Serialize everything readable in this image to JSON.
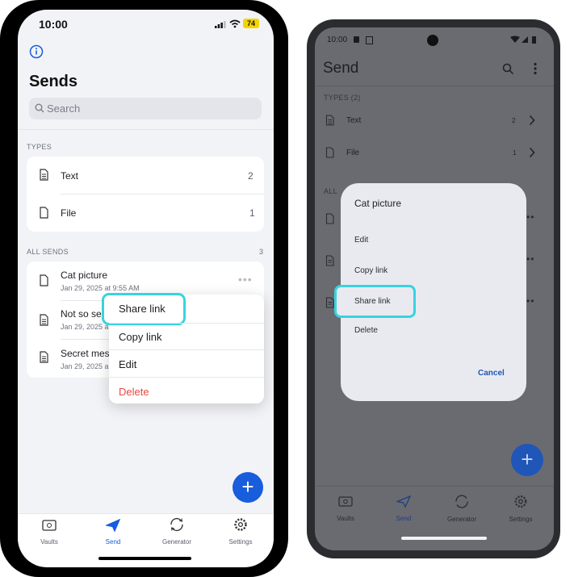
{
  "ios": {
    "time": "10:00",
    "battery": "74",
    "title": "Sends",
    "search_placeholder": "Search",
    "types_label": "TYPES",
    "types": [
      {
        "label": "Text",
        "count": "2"
      },
      {
        "label": "File",
        "count": "1"
      }
    ],
    "all_sends_label": "ALL SENDS",
    "all_sends_count": "3",
    "sends": [
      {
        "name": "Cat picture",
        "date": "Jan 29, 2025 at 9:55 AM"
      },
      {
        "name": "Not so secr",
        "date": "Jan 29, 2025 a"
      },
      {
        "name": "Secret mes",
        "date": "Jan 29, 2025 a"
      }
    ],
    "menu": {
      "share": "Share link",
      "copy": "Copy link",
      "edit": "Edit",
      "delete": "Delete"
    },
    "tabs": [
      "Vaults",
      "Send",
      "Generator",
      "Settings"
    ],
    "accent": "#175ddc",
    "danger": "#e5483f"
  },
  "android": {
    "time": "10:00",
    "title": "Send",
    "types_label": "TYPES (2)",
    "types": [
      {
        "label": "Text",
        "count": "2"
      },
      {
        "label": "File",
        "count": "1"
      }
    ],
    "all_label": "ALL",
    "dialog": {
      "title": "Cat picture",
      "edit": "Edit",
      "copy": "Copy link",
      "share": "Share link",
      "delete": "Delete",
      "cancel": "Cancel"
    },
    "tabs": [
      "Vaults",
      "Send",
      "Generator",
      "Settings"
    ]
  },
  "highlight_color": "#38d3e0"
}
